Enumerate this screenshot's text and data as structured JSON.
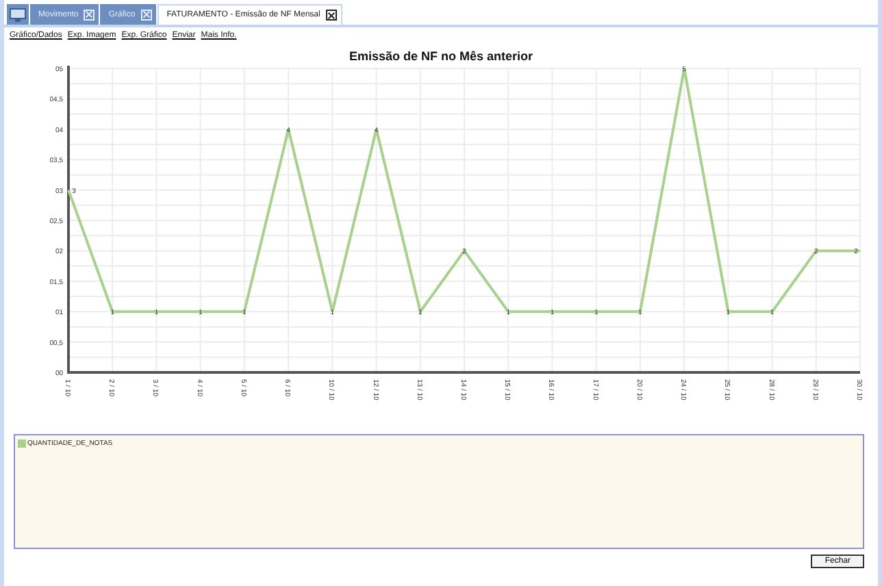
{
  "tabs": [
    {
      "label": "Movimento",
      "selected": false,
      "closable": true
    },
    {
      "label": "Gráfico",
      "selected": false,
      "closable": true
    },
    {
      "label": "FATURAMENTO - Emissão de NF Mensal",
      "selected": true,
      "closable": true
    }
  ],
  "links": [
    "Gráfico/Dados",
    "Exp. Imagem",
    "Exp. Gráfico",
    "Enviar",
    "Mais Info."
  ],
  "chart": {
    "chart_data": {
      "type": "line",
      "title": "Emissão de NF no Mês anterior",
      "categories": [
        "1 / 10",
        "2 / 10",
        "3 / 10",
        "4 / 10",
        "5 / 10",
        "6 / 10",
        "10 / 10",
        "12 / 10",
        "13 / 10",
        "14 / 10",
        "15 / 10",
        "16 / 10",
        "17 / 10",
        "20 / 10",
        "24 / 10",
        "25 / 10",
        "28 / 10",
        "29 / 10",
        "30 / 10"
      ],
      "series": [
        {
          "name": "QUANTIDADE_DE_NOTAS",
          "color": "#a9d18e",
          "values": [
            3,
            1,
            1,
            1,
            1,
            4,
            1,
            4,
            1,
            2,
            1,
            1,
            1,
            1,
            5,
            1,
            1,
            2,
            2
          ]
        }
      ],
      "ylim": [
        0,
        5
      ],
      "yticks": [
        {
          "value": 0,
          "label": "00"
        },
        {
          "value": 0.5,
          "label": "00,5"
        },
        {
          "value": 1,
          "label": "01"
        },
        {
          "value": 1.5,
          "label": "01,5"
        },
        {
          "value": 2,
          "label": "02"
        },
        {
          "value": 2.5,
          "label": "02,5"
        },
        {
          "value": 3,
          "label": "03"
        },
        {
          "value": 3.5,
          "label": "03,5"
        },
        {
          "value": 4,
          "label": "04"
        },
        {
          "value": 4.5,
          "label": "04,5"
        },
        {
          "value": 5,
          "label": "05"
        }
      ],
      "grid": true,
      "data_labels": true
    }
  },
  "buttons": [
    "Fechar"
  ]
}
